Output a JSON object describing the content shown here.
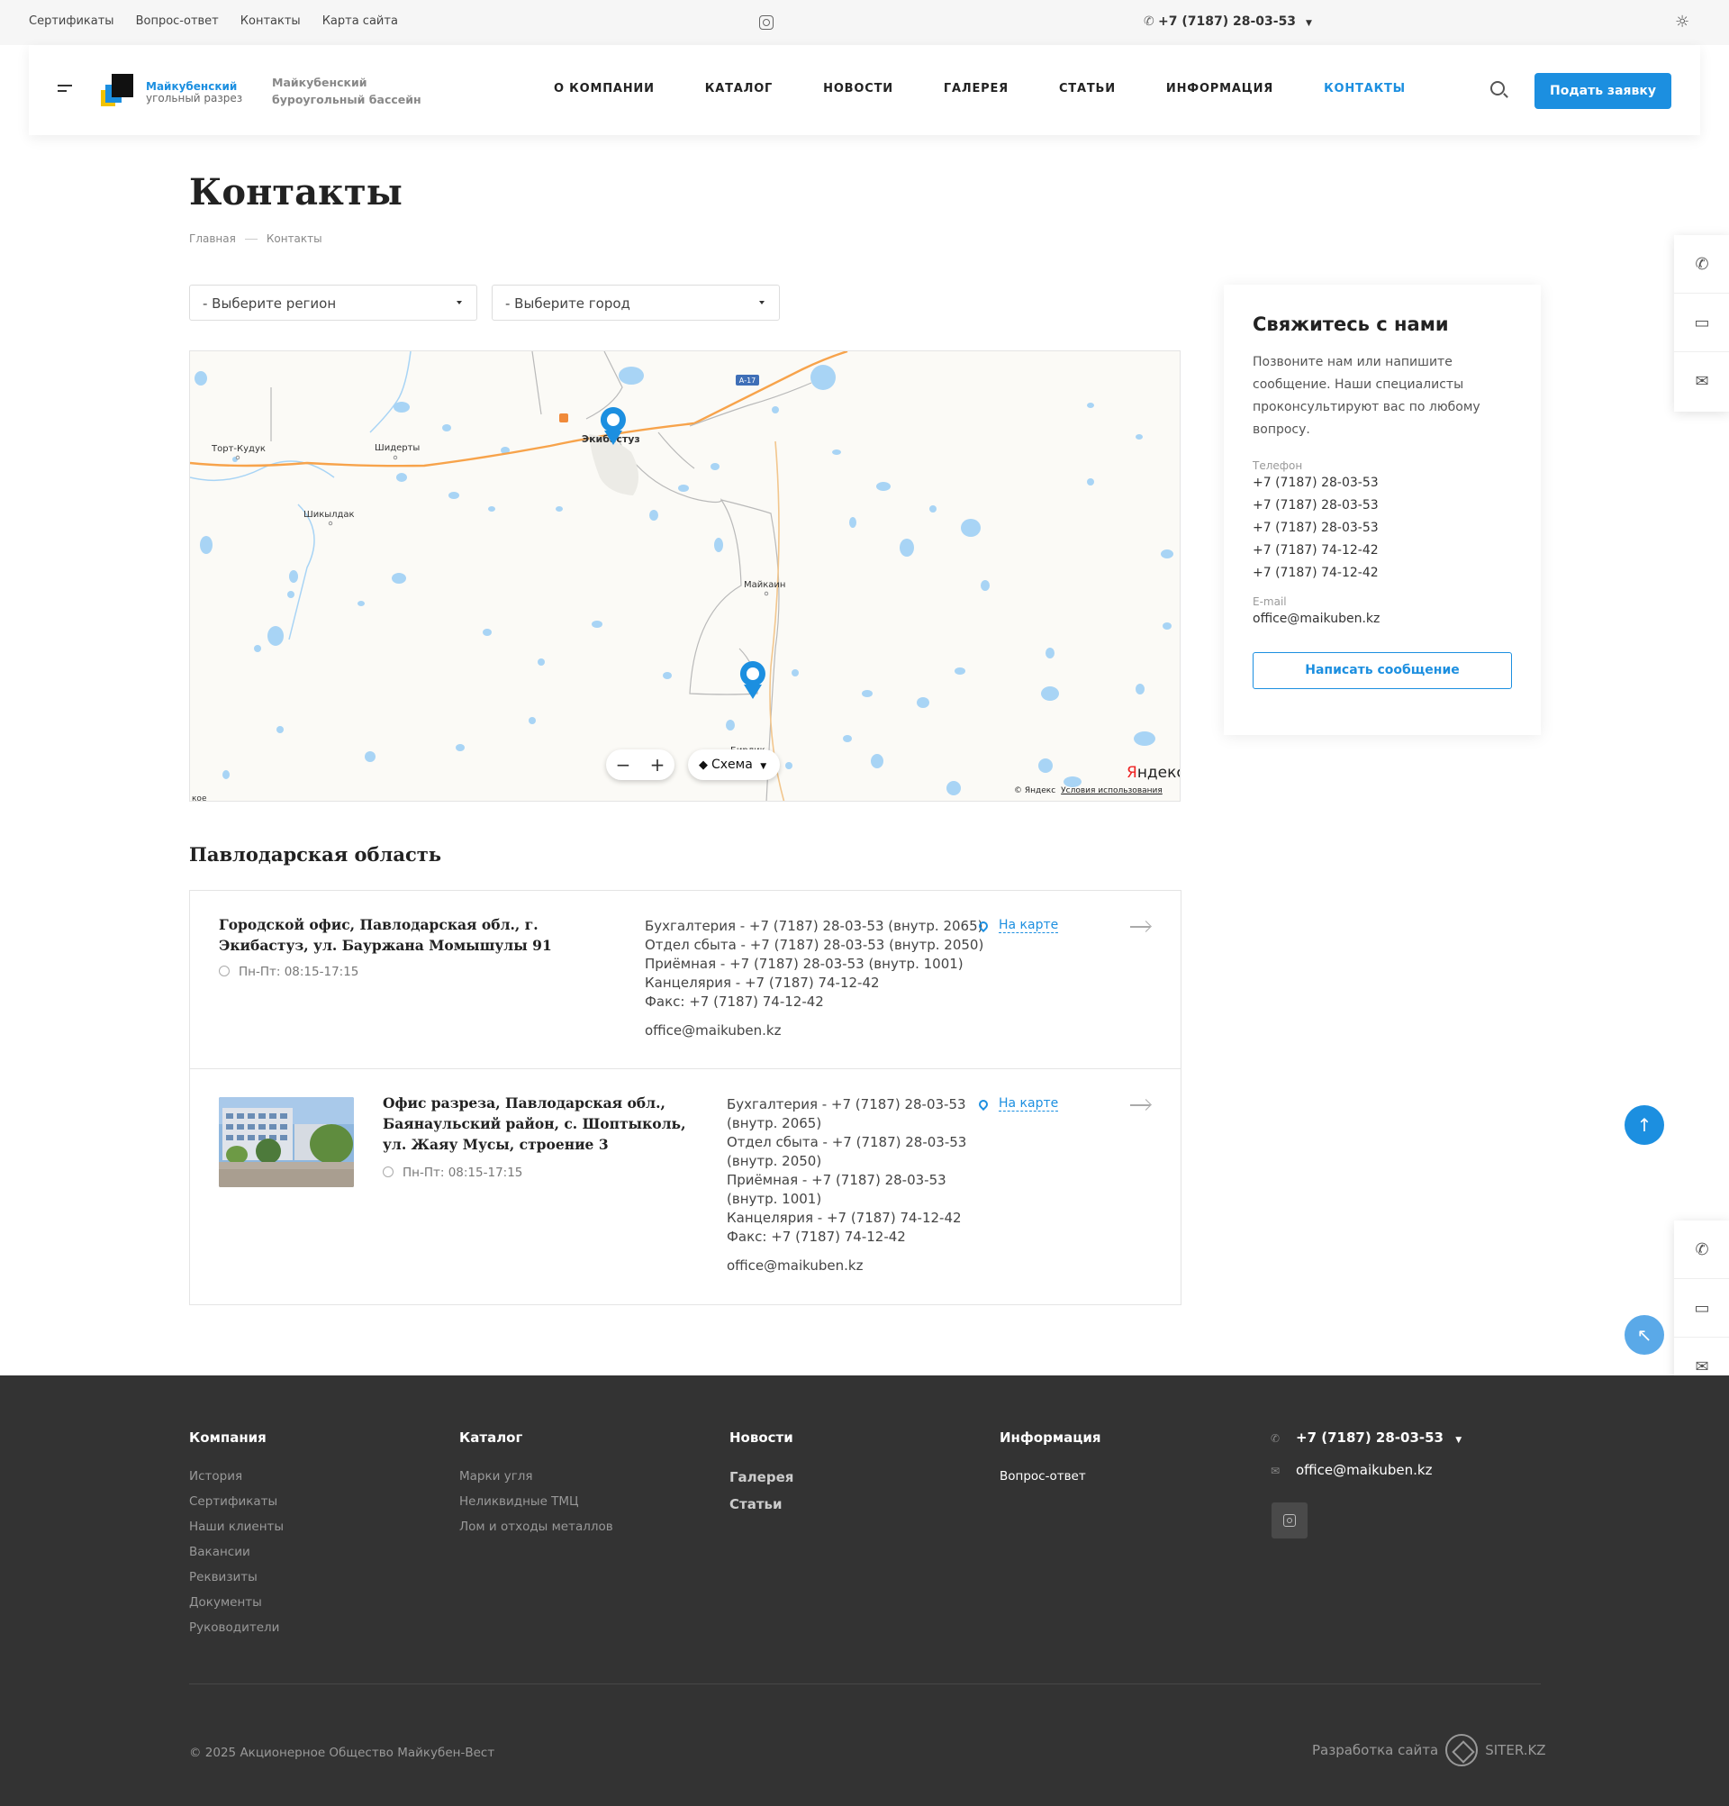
{
  "topbar": {
    "links": [
      "Сертификаты",
      "Вопрос-ответ",
      "Контакты",
      "Карта сайта"
    ],
    "phone": "+7 (7187) 28-03-53"
  },
  "header": {
    "logo_line1": "Майкубенский",
    "logo_line2": "угольный разрез",
    "slogan_line1": "Майкубенский",
    "slogan_line2": "буроугольный бассейн",
    "nav": [
      "О КОМПАНИИ",
      "КАТАЛОГ",
      "НОВОСТИ",
      "ГАЛЕРЕЯ",
      "СТАТЬИ",
      "ИНФОРМАЦИЯ",
      "КОНТАКТЫ"
    ],
    "apply_label": "Подать заявку"
  },
  "page": {
    "title": "Контакты",
    "breadcrumb": [
      "Главная",
      "Контакты"
    ],
    "region_select": "- Выберите регион",
    "city_select": "- Выберите город"
  },
  "map": {
    "places": [
      "Торт-Кудук",
      "Шидерты",
      "Экибастуз",
      "Шикылдак",
      "Майкаин",
      "Бирлик",
      "кое"
    ],
    "road_label": "А-17",
    "layers_label": "Схема",
    "logo": "Яндекс",
    "copyright": "© Яндекс",
    "terms": "Условия использования"
  },
  "contact_card": {
    "title": "Свяжитесь с нами",
    "description": "Позвоните нам или напишите сообщение. Наши специалисты проконсультируют вас по любому вопросу.",
    "phone_label": "Телефон",
    "phones": [
      "+7 (7187) 28-03-53",
      "+7 (7187) 28-03-53",
      "+7 (7187) 28-03-53",
      "+7 (7187) 74-12-42",
      "+7 (7187) 74-12-42"
    ],
    "email_label": "E-mail",
    "email": "office@maikuben.kz",
    "button": "Написать сообщение"
  },
  "region": {
    "title": "Павлодарская область",
    "offices": [
      {
        "title": "Городской офис, Павлодарская обл., г. Экибастуз, ул. Бауржана Момышулы 91",
        "hours": "Пн-Пт: 08:15-17:15",
        "phones": [
          "Бухгалтерия - +7 (7187) 28-03-53 (внутр. 2065)",
          "Отдел сбыта - +7 (7187) 28-03-53 (внутр. 2050)",
          "Приёмная - +7 (7187) 28-03-53 (внутр. 1001)",
          "Канцелярия - +7 (7187) 74-12-42",
          "Факс: +7 (7187) 74-12-42"
        ],
        "email": "office@maikuben.kz",
        "map_link": "На карте"
      },
      {
        "title": "Офис разреза, Павлодарская обл., Баянаульский район, с. Шоптыколь, ул. Жаяу Мусы, строение 3",
        "hours": "Пн-Пт: 08:15-17:15",
        "phones": [
          "Бухгалтерия - +7 (7187) 28-03-53",
          "(внутр. 2065)",
          "Отдел сбыта - +7 (7187) 28-03-53",
          "(внутр. 2050)",
          "Приёмная - +7 (7187) 28-03-53",
          "(внутр. 1001)",
          "Канцелярия - +7 (7187) 74-12-42",
          "Факс: +7 (7187) 74-12-42"
        ],
        "email": "office@maikuben.kz",
        "map_link": "На карте"
      }
    ]
  },
  "footer": {
    "company": {
      "title": "Компания",
      "items": [
        "История",
        "Сертификаты",
        "Наши клиенты",
        "Вакансии",
        "Реквизиты",
        "Документы",
        "Руководители"
      ]
    },
    "catalog": {
      "title": "Каталог",
      "items": [
        "Марки угля",
        "Неликвидные ТМЦ",
        "Лом и отходы металлов"
      ]
    },
    "news": {
      "title": "Новости",
      "items": [
        "Галерея",
        "Статьи"
      ]
    },
    "info": {
      "title": "Информация",
      "items": [
        "Вопрос-ответ"
      ]
    },
    "phone": "+7 (7187) 28-03-53",
    "email": "office@maikuben.kz",
    "copyright": "© 2025 Акционерное Общество Майкубен-Вест",
    "developer": "Разработка сайта",
    "developer_brand": "SITER.KZ"
  },
  "colors": {
    "accent": "#1c8fe0",
    "footer_bg": "#333333",
    "water": "#a8d4f5"
  }
}
